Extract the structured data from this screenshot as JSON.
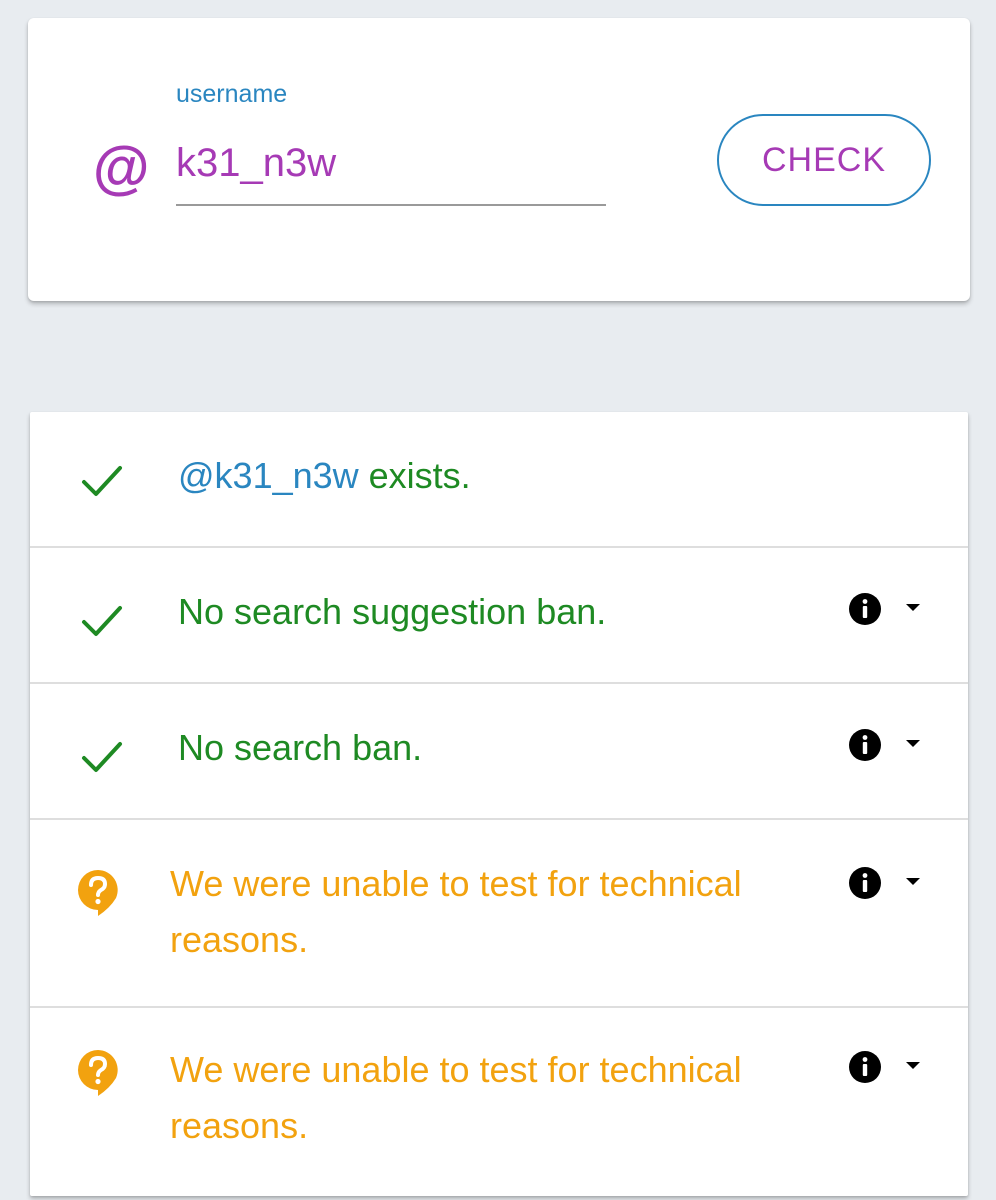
{
  "search": {
    "label": "username",
    "at_symbol": "@",
    "value": "k31_n3w",
    "button_label": "CHECK"
  },
  "results": {
    "exists": {
      "handle": "@k31_n3w",
      "text": " exists."
    },
    "rows": [
      {
        "status": "ok",
        "text": "No search suggestion ban."
      },
      {
        "status": "ok",
        "text": "No search ban."
      },
      {
        "status": "unknown",
        "text": "We were unable to test for technical reasons."
      },
      {
        "status": "unknown",
        "text": "We were unable to test for technical reasons."
      }
    ]
  },
  "colors": {
    "accent_purple": "#a63ab5",
    "accent_blue": "#2a86c0",
    "success_green": "#1e8a23",
    "warning_orange": "#f2a20f"
  },
  "icons": {
    "ok": "check-icon",
    "unknown": "question-bubble-icon",
    "info": "info-icon",
    "expand": "caret-down-icon"
  }
}
